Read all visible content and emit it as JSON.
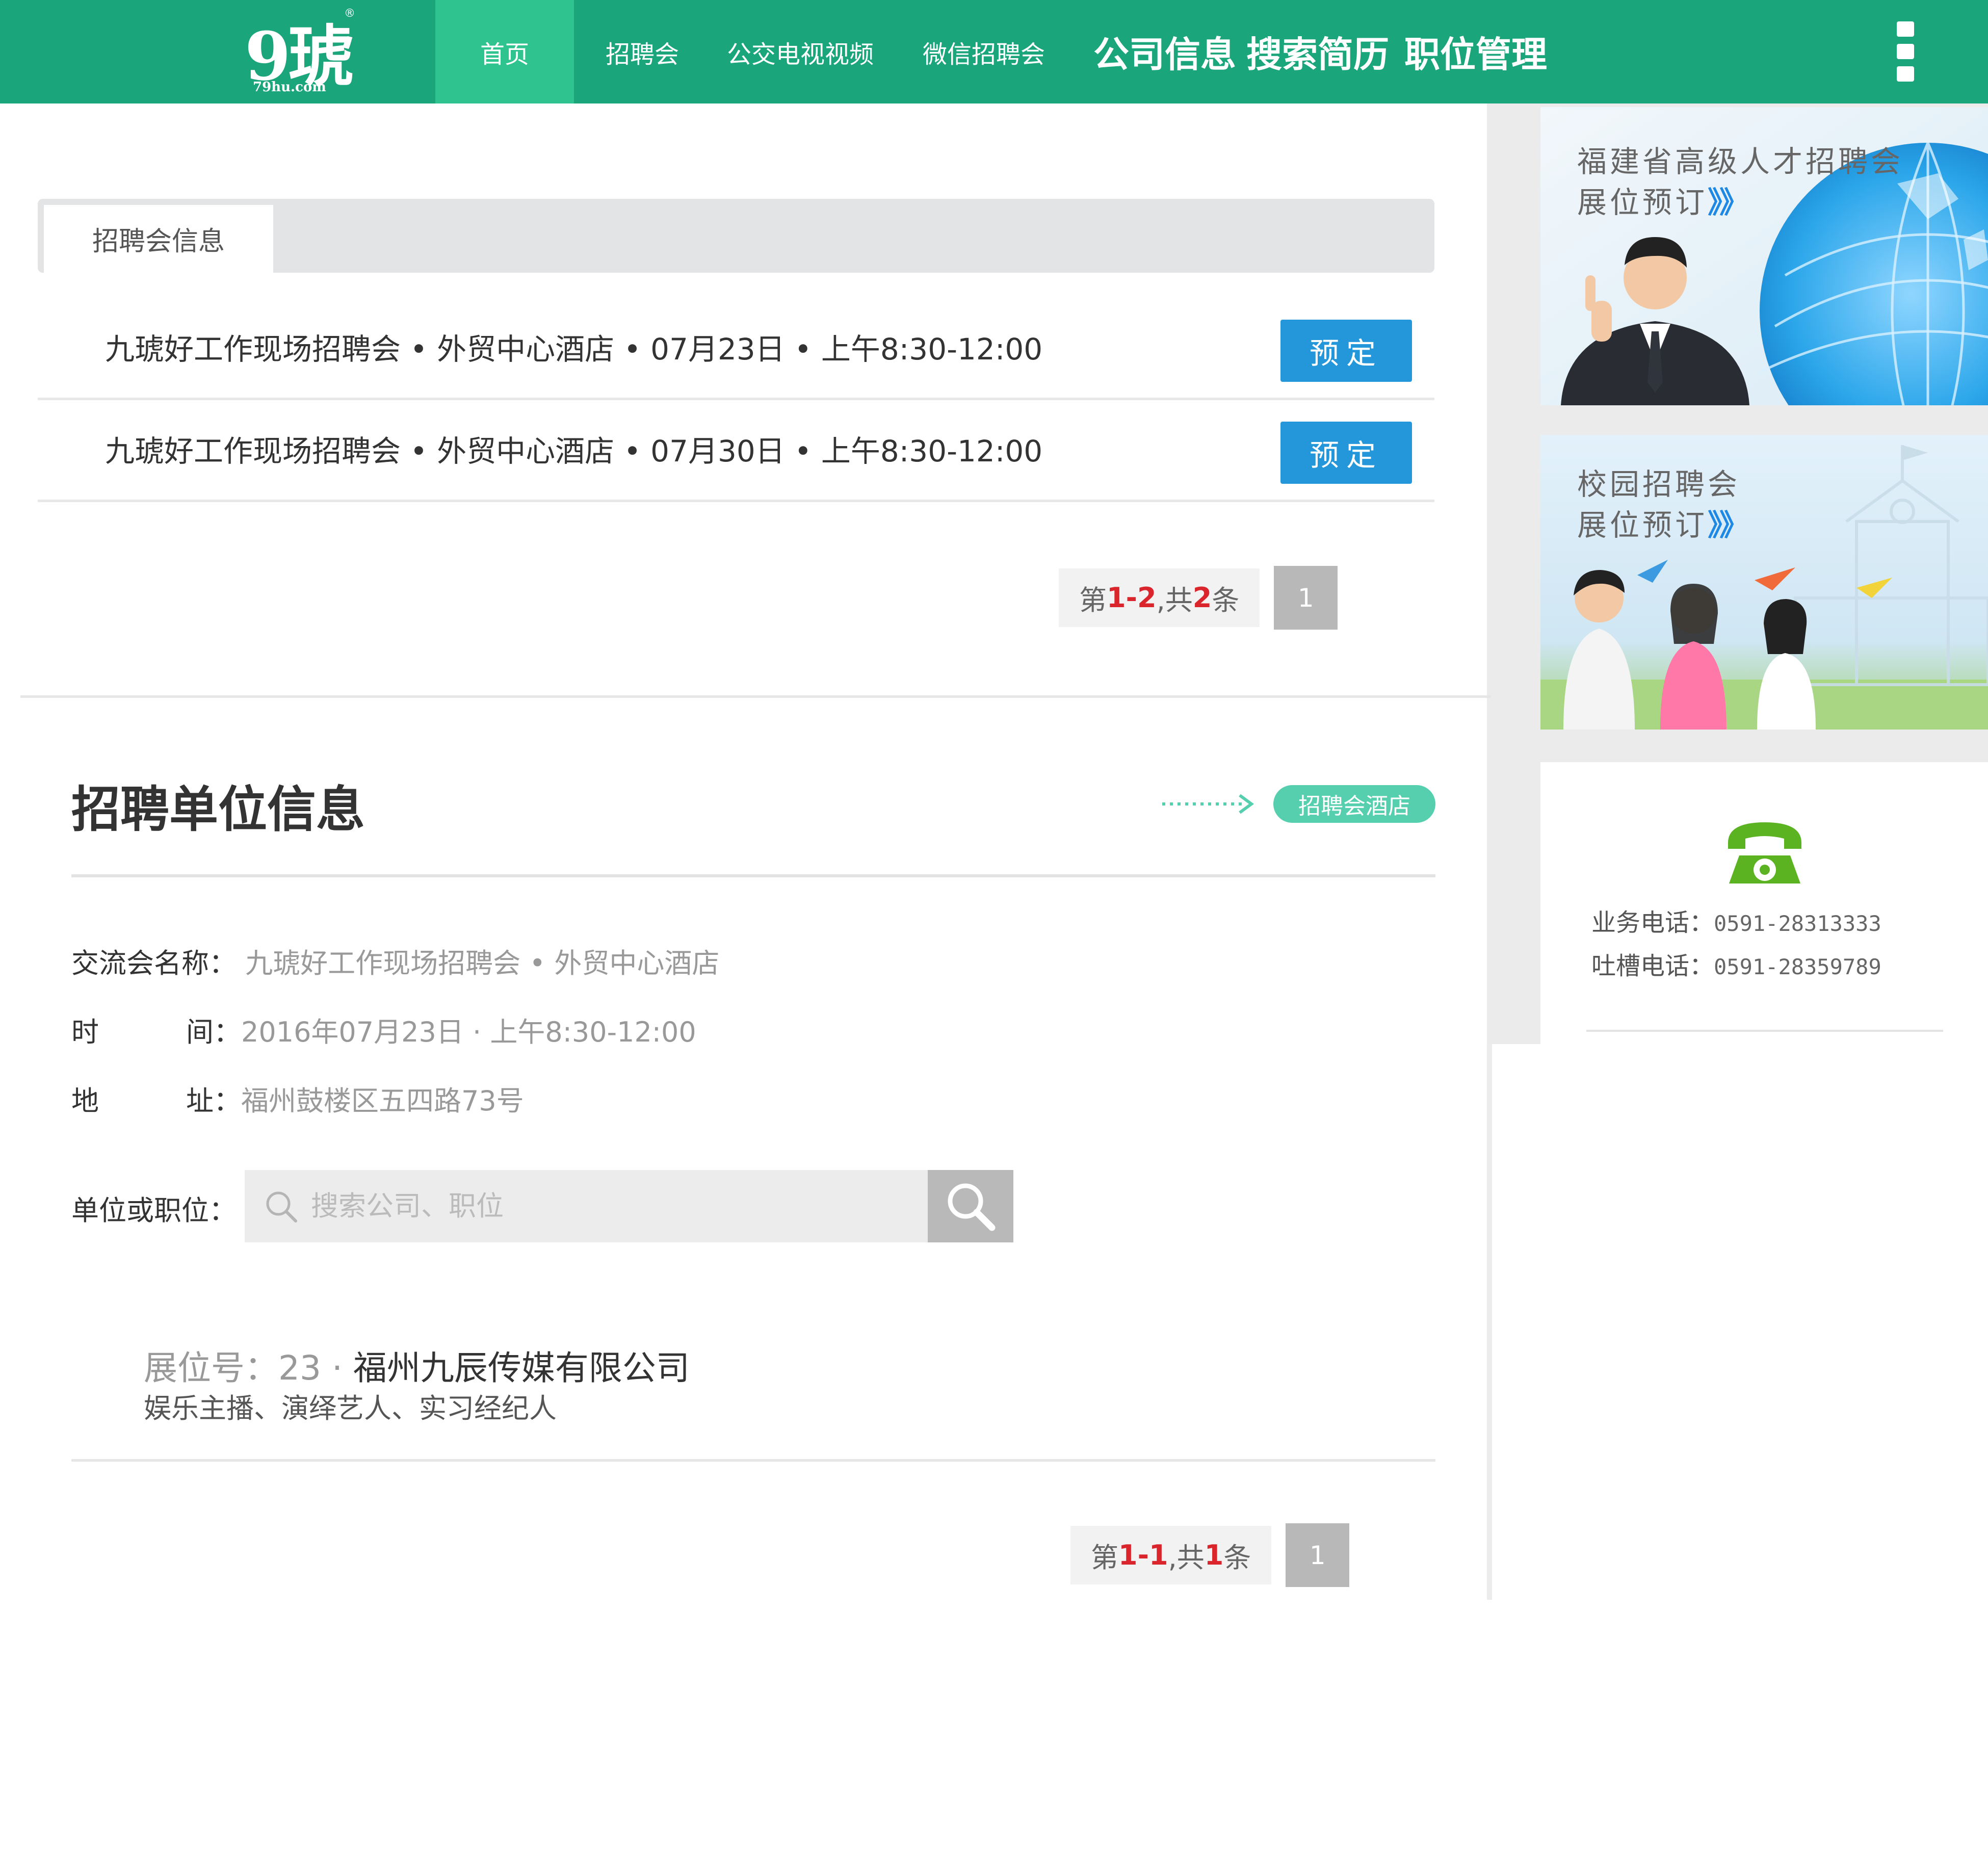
{
  "header": {
    "logo_main": "9琥",
    "logo_sub": "79hu.com",
    "logo_reg": "®",
    "nav": [
      {
        "label": "首页",
        "active": true
      },
      {
        "label": "招聘会",
        "active": false
      },
      {
        "label": "公交电视视频",
        "active": false
      },
      {
        "label": "微信招聘会",
        "active": false
      },
      {
        "label": "公司信息",
        "active": false
      },
      {
        "label": "搜索简历",
        "active": false
      },
      {
        "label": "职位管理",
        "active": false
      }
    ],
    "menu_icon": "more-vertical-icon"
  },
  "fair_info": {
    "tab_label": "招聘会信息",
    "rows": [
      {
        "text": "九琥好工作现场招聘会 • 外贸中心酒店 • 07月23日 • 上午8:30-12:00",
        "button": "预定"
      },
      {
        "text": "九琥好工作现场招聘会 • 外贸中心酒店 • 07月30日 • 上午8:30-12:00",
        "button": "预定"
      }
    ],
    "pager": {
      "pre": "第",
      "from": "1",
      "dash": "-",
      "to": "2",
      "mid": ",共",
      "total": "2",
      "post": "条",
      "page": "1"
    }
  },
  "unit_info": {
    "title": "招聘单位信息",
    "hotel_tag": "招聘会酒店",
    "fair_name_label": "交流会名称：",
    "fair_name": "九琥好工作现场招聘会 • 外贸中心酒店",
    "time_label_a": "时",
    "time_label_b": "间：",
    "time": "2016年07月23日 · 上午8:30-12:00",
    "addr_label_a": "地",
    "addr_label_b": "址：",
    "address": "福州鼓楼区五四路73号",
    "search_label": "单位或职位：",
    "search_placeholder": "搜索公司、职位",
    "booth_prefix": "展位号：23 · ",
    "company": "福州九辰传媒有限公司",
    "jobs": "娱乐主播、演绎艺人、实习经纪人",
    "pager": {
      "pre": "第",
      "from": "1",
      "dash": "-",
      "to": "1",
      "mid": ",共",
      "total": "1",
      "post": "条",
      "page": "1"
    }
  },
  "sidebar": {
    "banner1": {
      "title": "福建省高级人才招聘会",
      "sub": "展位预订",
      "arrows": "》》"
    },
    "banner2": {
      "title": "校园招聘会",
      "sub": "展位预订",
      "arrows": "》》"
    },
    "contact": {
      "phone_icon": "telephone-icon",
      "business_label": "业务电话：",
      "business_phone": "0591-28313333",
      "complaint_label": "吐槽电话：",
      "complaint_phone": "0591-28359789"
    }
  },
  "colors": {
    "brand_green": "#1aa57a",
    "nav_active": "#2fc390",
    "book_blue": "#2497db",
    "pager_red": "#d9252b",
    "tag_teal": "#55cfae",
    "phone_green": "#5bb322"
  }
}
